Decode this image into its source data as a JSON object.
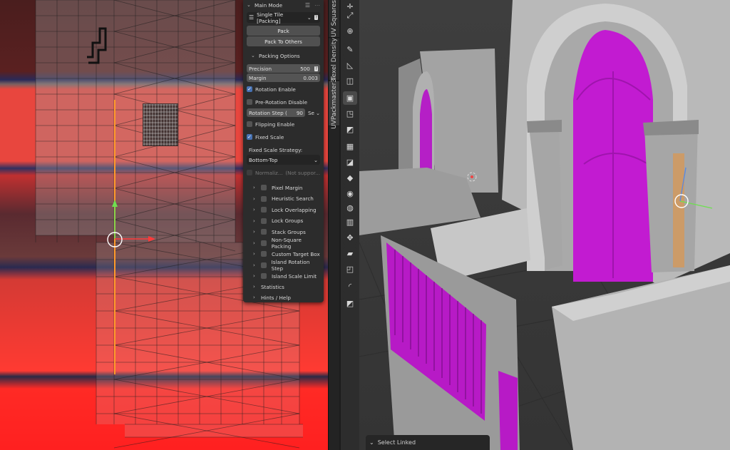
{
  "sidebar": {
    "tabs": [
      "UV Squares",
      "Texel Density",
      "UVPackmaster3"
    ]
  },
  "panel": {
    "mode_label": "Main Mode",
    "mode_value": "Single Tile [Packing]",
    "pack_label": "Pack",
    "pack_to_others_label": "Pack To Others",
    "packing_options_label": "Packing Options",
    "precision_label": "Precision",
    "precision_value": "500",
    "margin_label": "Margin",
    "margin_value": "0.003",
    "rotation_enable_label": "Rotation Enable",
    "pre_rotation_label": "Pre-Rotation Disable",
    "rotation_step_label": "Rotation Step (",
    "rotation_step_value": "90",
    "rotation_step_suffix": "Se",
    "flipping_label": "Flipping Enable",
    "fixed_scale_label": "Fixed Scale",
    "fixed_scale_strategy_label": "Fixed Scale Strategy:",
    "fixed_scale_strategy_value": "Bottom-Top",
    "normalize_label": "Normaliz...",
    "not_supported_label": "(Not suppor...",
    "sections": [
      "Pixel Margin",
      "Heuristic Search",
      "Lock Overlapping",
      "Lock Groups",
      "Stack Groups",
      "Non-Square Packing",
      "Custom Target Box",
      "Island Rotation Step",
      "Island Scale Limit"
    ],
    "statistics_label": "Statistics",
    "hints_label": "Hints / Help"
  },
  "statusbar": {
    "text": "Select Linked"
  },
  "colors": {
    "accent": "#4772b3",
    "magenta": "#c21bd1",
    "uv_red": "#ff3a32"
  }
}
